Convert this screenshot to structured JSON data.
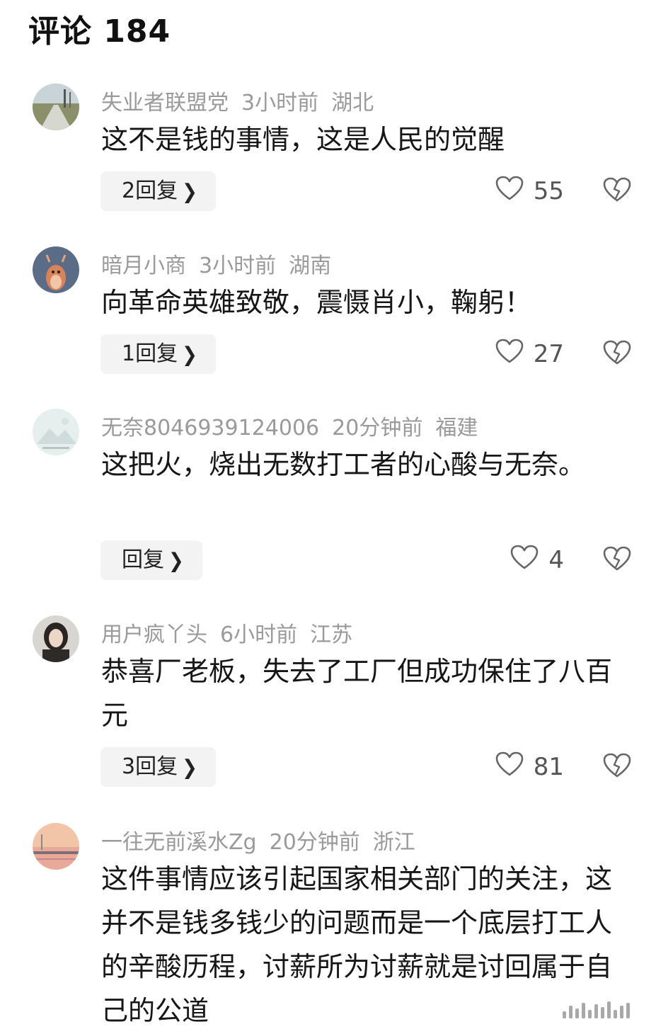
{
  "header": {
    "title": "评论 184"
  },
  "comments": [
    {
      "user": "失业者联盟党",
      "time": "3小时前",
      "location": "湖北",
      "text": "这不是钱的事情，这是人民的觉醒",
      "reply_label": "2回复",
      "likes": "55",
      "avatar_icon": "road-landscape-avatar"
    },
    {
      "user": "暗月小商",
      "time": "3小时前",
      "location": "湖南",
      "text": "向革命英雄致敬，震慑肖小，鞠躬！",
      "reply_label": "1回复",
      "likes": "27",
      "avatar_icon": "cartoon-deer-avatar"
    },
    {
      "user": "无奈8046939124006",
      "time": "20分钟前",
      "location": "福建",
      "text": "这把火，烧出无数打工者的心酸与无奈。",
      "reply_label": "回复",
      "likes": "4",
      "avatar_icon": "default-mountain-avatar"
    },
    {
      "user": "用户疯丫头",
      "time": "6小时前",
      "location": "江苏",
      "text": "恭喜厂老板，失去了工厂但成功保住了八百元",
      "reply_label": "3回复",
      "likes": "81",
      "avatar_icon": "girl-portrait-avatar"
    },
    {
      "user": "一往无前溪水Zg",
      "time": "20分钟前",
      "location": "浙江",
      "text": "这件事情应该引起国家相关部门的关注，这并不是钱多钱少的问题而是一个底层打工人的辛酸历程，讨薪所为讨薪就是讨回属于自己的公道",
      "avatar_icon": "sunset-sea-avatar"
    }
  ],
  "icons": {
    "like": "heart-outline-icon",
    "dislike": "broken-heart-icon",
    "chevron": "chevron-right-icon"
  },
  "colors": {
    "meta_gray": "#9a9a9a",
    "text_dark": "#161616",
    "reply_bg": "#f3f3f3"
  }
}
